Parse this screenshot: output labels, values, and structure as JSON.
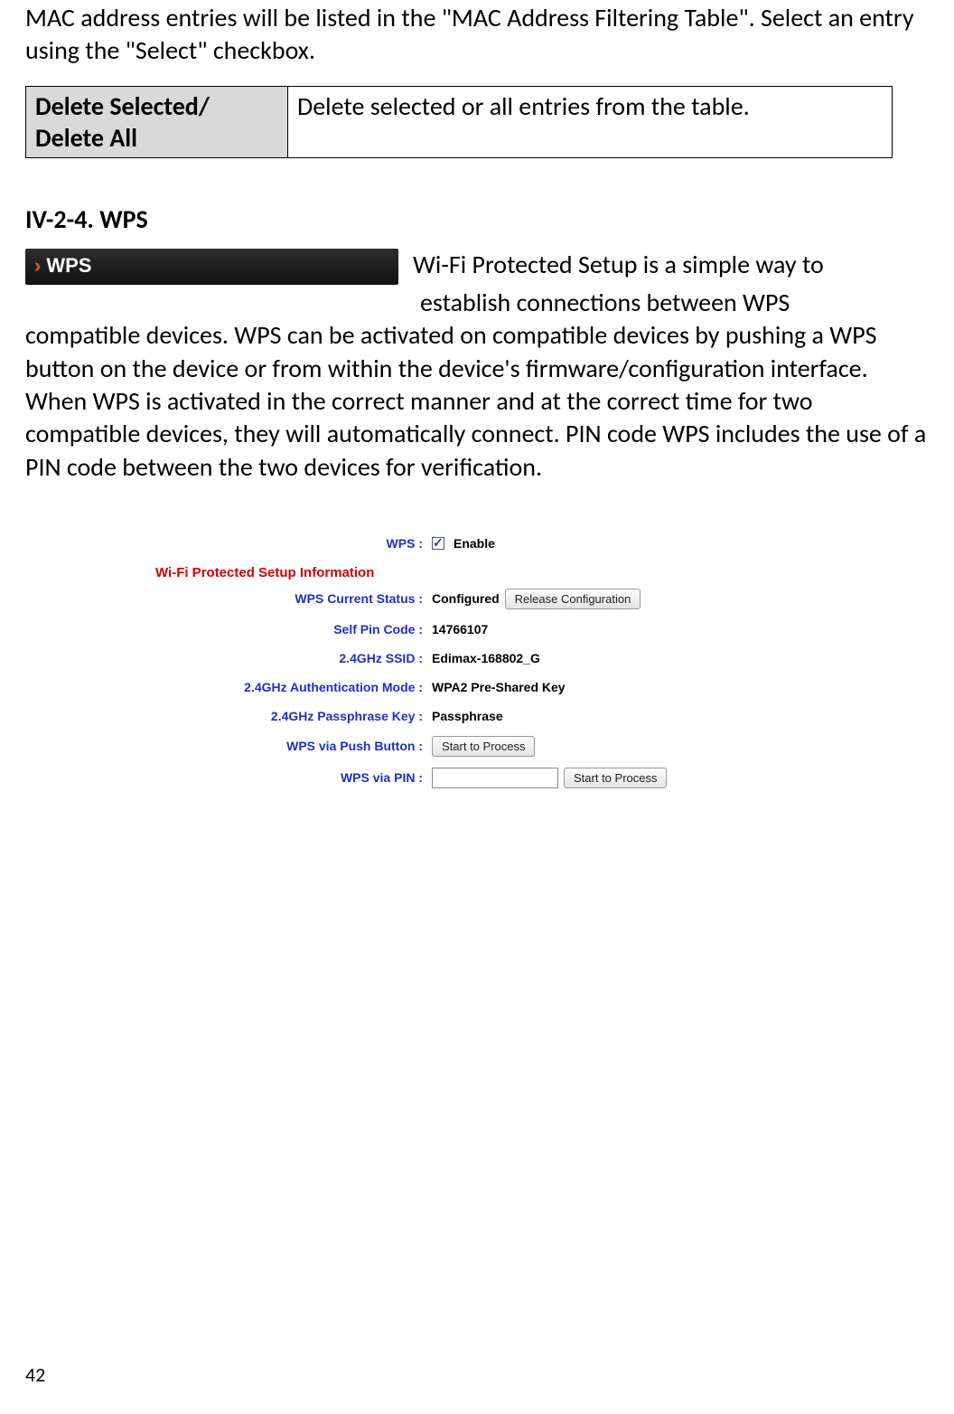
{
  "intro_text": "MAC address entries will be listed in the \"MAC Address Filtering Table\". Select an entry using the \"Select\" checkbox.",
  "def_table": {
    "header": "Delete Selected/ Delete All",
    "desc": "Delete selected or all entries from the table."
  },
  "section_heading": "IV-2-4. WPS",
  "wps_pill_label": "WPS",
  "wps_body_line1": "Wi-Fi Protected Setup is a simple way to",
  "wps_body_line2": "establish connections between WPS",
  "wps_body_rest": "compatible devices. WPS can be activated on compatible devices by pushing a WPS button on the device or from within the device's firmware/configuration interface. When WPS is activated in the correct manner and at the correct time for two compatible devices, they will automatically connect. PIN code WPS includes the use of a PIN code between the two devices for verification.",
  "config": {
    "wps_label": "WPS :",
    "enable_label": "Enable",
    "section_title": "Wi-Fi Protected Setup Information",
    "status_label": "WPS Current Status :",
    "status_value": "Configured",
    "release_btn": "Release Configuration",
    "self_pin_label": "Self Pin Code :",
    "self_pin_value": "14766107",
    "ssid_label": "2.4GHz SSID :",
    "ssid_value": "Edimax-168802_G",
    "auth_label": "2.4GHz Authentication Mode :",
    "auth_value": "WPA2 Pre-Shared Key",
    "pass_label": "2.4GHz Passphrase Key :",
    "pass_value": "Passphrase",
    "push_label": "WPS via Push Button :",
    "push_btn": "Start to Process",
    "pin_label": "WPS via PIN :",
    "pin_btn": "Start to Process"
  },
  "page_number": "42"
}
